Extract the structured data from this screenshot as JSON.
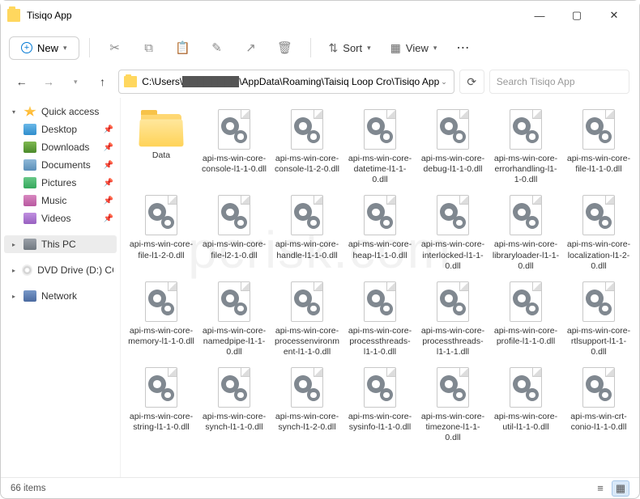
{
  "window": {
    "title": "Tisiqo App"
  },
  "toolbar": {
    "new": "New",
    "sort": "Sort",
    "view": "View"
  },
  "address": {
    "prefix": "C:\\Users\\",
    "redacted": "████████",
    "suffix": "\\AppData\\Roaming\\Taisiq Loop Cro\\Tisiqo App"
  },
  "search": {
    "placeholder": "Search Tisiqo App"
  },
  "sidebar": {
    "quick": "Quick access",
    "items": [
      {
        "label": "Desktop"
      },
      {
        "label": "Downloads"
      },
      {
        "label": "Documents"
      },
      {
        "label": "Pictures"
      },
      {
        "label": "Music"
      },
      {
        "label": "Videos"
      }
    ],
    "thispc": "This PC",
    "dvd": "DVD Drive (D:) CCCC",
    "network": "Network"
  },
  "files": [
    {
      "type": "folder",
      "name": "Data"
    },
    {
      "type": "dll",
      "name": "api-ms-win-core-console-l1-1-0.dll"
    },
    {
      "type": "dll",
      "name": "api-ms-win-core-console-l1-2-0.dll"
    },
    {
      "type": "dll",
      "name": "api-ms-win-core-datetime-l1-1-0.dll"
    },
    {
      "type": "dll",
      "name": "api-ms-win-core-debug-l1-1-0.dll"
    },
    {
      "type": "dll",
      "name": "api-ms-win-core-errorhandling-l1-1-0.dll"
    },
    {
      "type": "dll",
      "name": "api-ms-win-core-file-l1-1-0.dll"
    },
    {
      "type": "dll",
      "name": "api-ms-win-core-file-l1-2-0.dll"
    },
    {
      "type": "dll",
      "name": "api-ms-win-core-file-l2-1-0.dll"
    },
    {
      "type": "dll",
      "name": "api-ms-win-core-handle-l1-1-0.dll"
    },
    {
      "type": "dll",
      "name": "api-ms-win-core-heap-l1-1-0.dll"
    },
    {
      "type": "dll",
      "name": "api-ms-win-core-interlocked-l1-1-0.dll"
    },
    {
      "type": "dll",
      "name": "api-ms-win-core-libraryloader-l1-1-0.dll"
    },
    {
      "type": "dll",
      "name": "api-ms-win-core-localization-l1-2-0.dll"
    },
    {
      "type": "dll",
      "name": "api-ms-win-core-memory-l1-1-0.dll"
    },
    {
      "type": "dll",
      "name": "api-ms-win-core-namedpipe-l1-1-0.dll"
    },
    {
      "type": "dll",
      "name": "api-ms-win-core-processenvironment-l1-1-0.dll"
    },
    {
      "type": "dll",
      "name": "api-ms-win-core-processthreads-l1-1-0.dll"
    },
    {
      "type": "dll",
      "name": "api-ms-win-core-processthreads-l1-1-1.dll"
    },
    {
      "type": "dll",
      "name": "api-ms-win-core-profile-l1-1-0.dll"
    },
    {
      "type": "dll",
      "name": "api-ms-win-core-rtlsupport-l1-1-0.dll"
    },
    {
      "type": "dll",
      "name": "api-ms-win-core-string-l1-1-0.dll"
    },
    {
      "type": "dll",
      "name": "api-ms-win-core-synch-l1-1-0.dll"
    },
    {
      "type": "dll",
      "name": "api-ms-win-core-synch-l1-2-0.dll"
    },
    {
      "type": "dll",
      "name": "api-ms-win-core-sysinfo-l1-1-0.dll"
    },
    {
      "type": "dll",
      "name": "api-ms-win-core-timezone-l1-1-0.dll"
    },
    {
      "type": "dll",
      "name": "api-ms-win-core-util-l1-1-0.dll"
    },
    {
      "type": "dll",
      "name": "api-ms-win-crt-conio-l1-1-0.dll"
    }
  ],
  "status": {
    "count": "66 items"
  }
}
